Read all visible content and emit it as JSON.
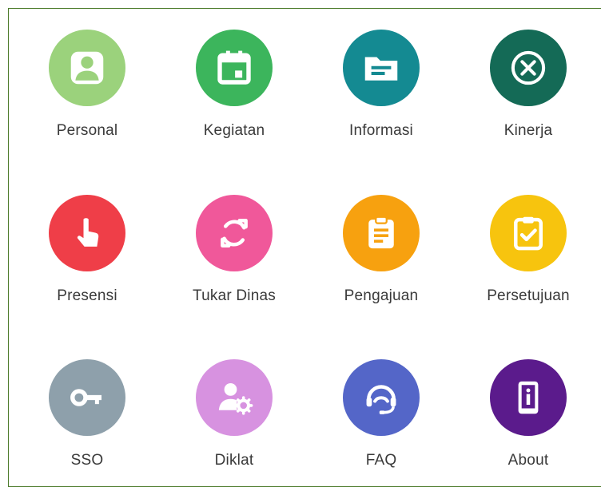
{
  "menu": {
    "items": [
      {
        "label": "Personal",
        "icon": "person-icon",
        "color": "#9bd27c"
      },
      {
        "label": "Kegiatan",
        "icon": "calendar-icon",
        "color": "#3cb55c"
      },
      {
        "label": "Informasi",
        "icon": "folder-icon",
        "color": "#148a92"
      },
      {
        "label": "Kinerja",
        "icon": "close-circle-icon",
        "color": "#146a56"
      },
      {
        "label": "Presensi",
        "icon": "touch-icon",
        "color": "#ef3e48"
      },
      {
        "label": "Tukar Dinas",
        "icon": "sync-icon",
        "color": "#f0589a"
      },
      {
        "label": "Pengajuan",
        "icon": "clipboard-list-icon",
        "color": "#f7a10f"
      },
      {
        "label": "Persetujuan",
        "icon": "clipboard-check-icon",
        "color": "#f7c40e"
      },
      {
        "label": "SSO",
        "icon": "key-icon",
        "color": "#8ea0ab"
      },
      {
        "label": "Diklat",
        "icon": "user-settings-icon",
        "color": "#d792e0"
      },
      {
        "label": "FAQ",
        "icon": "headset-icon",
        "color": "#5466c8"
      },
      {
        "label": "About",
        "icon": "info-device-icon",
        "color": "#5b1b8c"
      }
    ]
  }
}
